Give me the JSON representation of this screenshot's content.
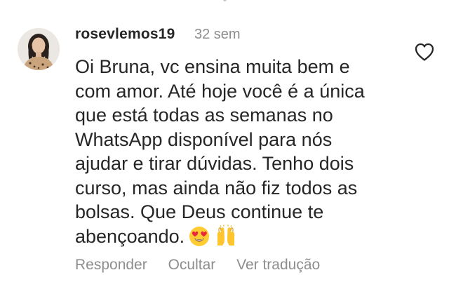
{
  "comment": {
    "username": "rosevlemos19",
    "timestamp": "32 sem",
    "lines": [
      "Oi Bruna, vc ensina muita bem e",
      "com amor. Até hoje você é a única",
      "que está todas as semanas no",
      "WhatsApp disponível para nós",
      "ajudar e tirar dúvidas.  Tenho dois",
      "curso, mas ainda não fiz todos as",
      "bolsas. Que Deus continue te",
      "abençoando."
    ],
    "emojis": [
      "heart-eyes-emoji",
      "raising-hands-emoji"
    ]
  },
  "actions": {
    "reply": "Responder",
    "hide": "Ocultar",
    "translate": "Ver tradução"
  },
  "icons": {
    "like": "heart-outline-icon"
  },
  "colors": {
    "text": "#262626",
    "muted": "#8e8e8e",
    "background": "#ffffff"
  }
}
